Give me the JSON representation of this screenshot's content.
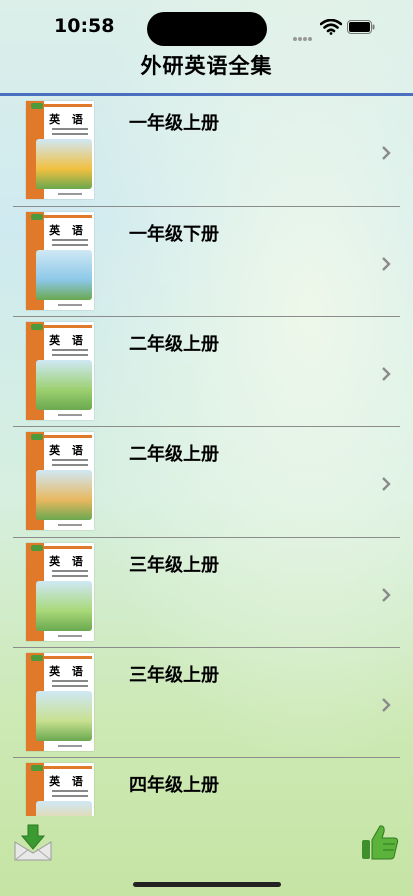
{
  "status": {
    "time": "10:58"
  },
  "header": {
    "title": "外研英语全集"
  },
  "cover_title": "英 语",
  "books": [
    {
      "label": "一年级上册",
      "art": "#f2c040"
    },
    {
      "label": "一年级下册",
      "art": "#8cc8e8"
    },
    {
      "label": "二年级上册",
      "art": "#9cd070"
    },
    {
      "label": "二年级上册",
      "art": "#e8b860"
    },
    {
      "label": "三年级上册",
      "art": "#a8d878"
    },
    {
      "label": "三年级上册",
      "art": "#c8e090"
    },
    {
      "label": "四年级上册",
      "art": "#f0d080"
    }
  ],
  "toolbar": {
    "left_icon": "download-mail-icon",
    "right_icon": "thumbs-up-icon"
  },
  "colors": {
    "accent_rule": "#4a6fc0",
    "cover_band": "#e07a2a"
  }
}
